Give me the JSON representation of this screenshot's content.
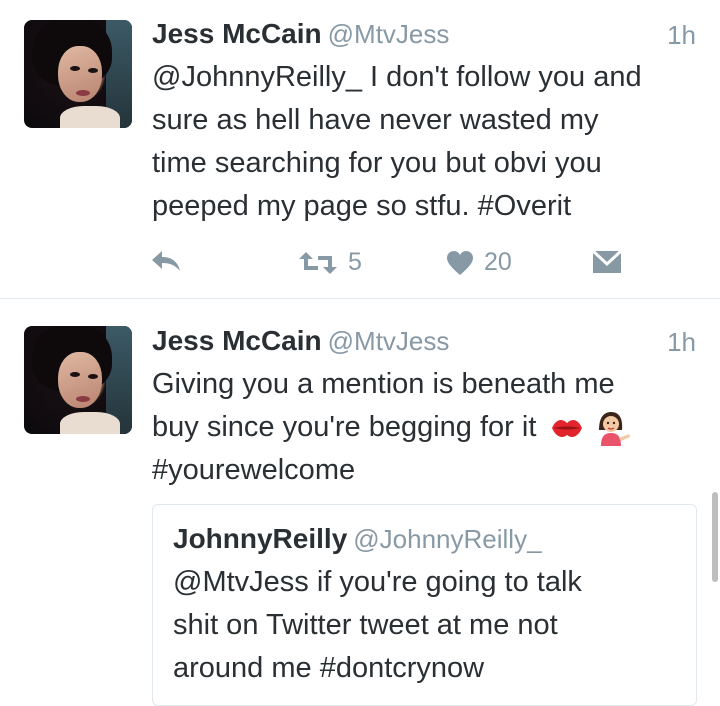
{
  "tweets": [
    {
      "name": "Jess McCain",
      "handle": "@MtvJess",
      "time": "1h",
      "lines": [
        "@JohnnyReilly_ I don't follow you and",
        "sure as hell have never wasted my",
        "time searching for you but obvi you",
        "peeped my page so stfu. #Overit"
      ],
      "retweets": "5",
      "likes": "20",
      "icons": [
        "reply-icon",
        "retweet-icon",
        "heart-icon",
        "direct-message-icon"
      ]
    },
    {
      "name": "Jess McCain",
      "handle": "@MtvJess",
      "time": "1h",
      "lines": [
        "Giving you a mention is beneath me",
        "buy since you're begging for it",
        "#yourewelcome"
      ],
      "emojis": [
        "kiss-mark-emoji",
        "woman-tipping-hand-emoji"
      ],
      "quoted": {
        "name": "JohnnyReilly",
        "handle": "@JohnnyReilly_",
        "lines": [
          "@MtvJess if you're going to talk",
          "shit on Twitter tweet at me not",
          "around me #dontcrynow"
        ]
      }
    }
  ],
  "colors": {
    "text": "#292f33",
    "muted": "#8899a6",
    "divider": "#e1e8ed"
  }
}
